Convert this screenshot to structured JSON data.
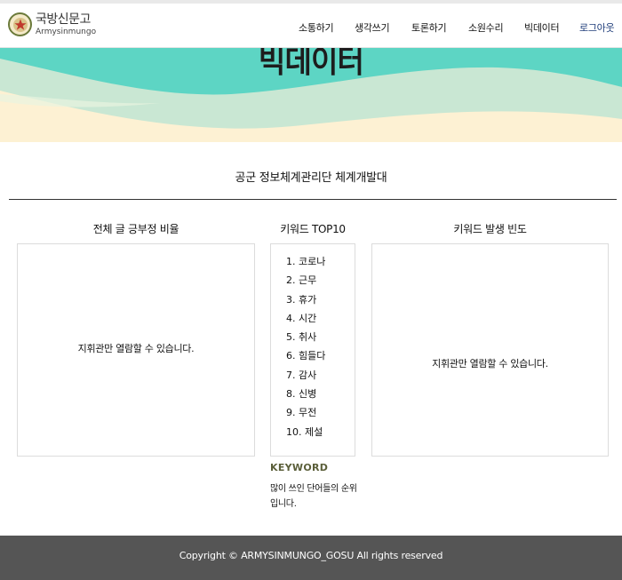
{
  "logo": {
    "name_ko": "국방신문고",
    "name_en": "Armysinmungo",
    "icon": "star-emblem-icon"
  },
  "nav": {
    "items": [
      {
        "label": "소통하기"
      },
      {
        "label": "생각쓰기"
      },
      {
        "label": "토론하기"
      },
      {
        "label": "소원수리"
      },
      {
        "label": "빅데이터"
      },
      {
        "label": "로그아웃"
      }
    ]
  },
  "banner": {
    "title": "빅데이터",
    "colors": {
      "teal": "#5dd5c4",
      "mint": "#c9e7d3",
      "cream": "#fdf1d3"
    }
  },
  "section": {
    "title": "공군 정보체계관리단 체계개발대"
  },
  "left": {
    "heading": "전체 글 긍부정 비율",
    "message": "지휘관만 열람할 수 있습니다."
  },
  "middle": {
    "heading": "키워드 TOP10",
    "keywords": [
      "1. 코로나",
      "2. 근무",
      "3. 휴가",
      "4. 시간",
      "5. 취사",
      "6. 힘들다",
      "7. 감사",
      "8. 신병",
      "9. 무전",
      "10. 제설"
    ],
    "label": "KEYWORD",
    "description": "많이 쓰인 단어들의 순위입니다."
  },
  "right": {
    "heading": "키워드 발생 빈도",
    "message": "지휘관만 열람할 수 있습니다."
  },
  "footer": {
    "copyright": "Copyright © ARMYSINMUNGO_GOSU All rights reserved"
  }
}
